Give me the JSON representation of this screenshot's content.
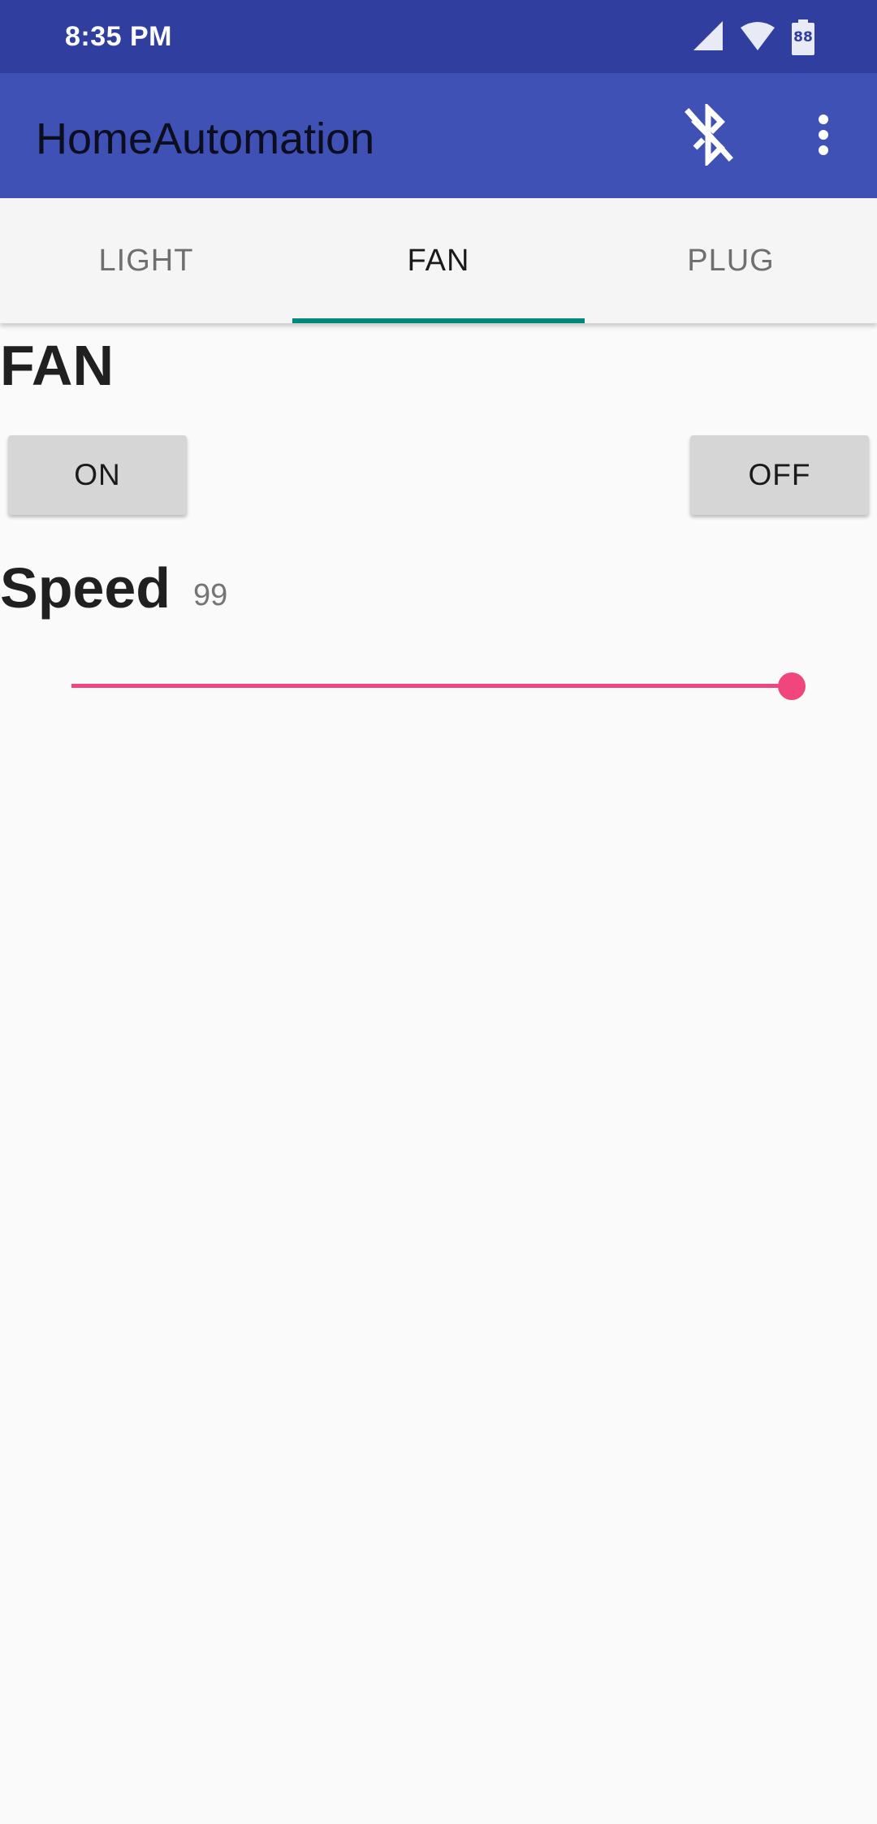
{
  "status_bar": {
    "time": "8:35 PM",
    "battery_level": "88",
    "icons": [
      "signal-icon",
      "wifi-icon",
      "battery-icon"
    ]
  },
  "app_bar": {
    "title": "HomeAutomation",
    "actions": [
      "bluetooth-disabled-icon",
      "more-vert-icon"
    ]
  },
  "tabs": [
    {
      "label": "LIGHT",
      "active": false
    },
    {
      "label": "FAN",
      "active": true
    },
    {
      "label": "PLUG",
      "active": false
    }
  ],
  "main": {
    "section_title": "FAN",
    "on_label": "ON",
    "off_label": "OFF",
    "speed_label": "Speed",
    "speed_value": "99",
    "slider": {
      "value": 99,
      "max": 100
    }
  },
  "colors": {
    "status_bar": "#303f9f",
    "app_bar": "#3f51b5",
    "tab_indicator": "#00897b",
    "slider_accent": "#f0457d"
  }
}
